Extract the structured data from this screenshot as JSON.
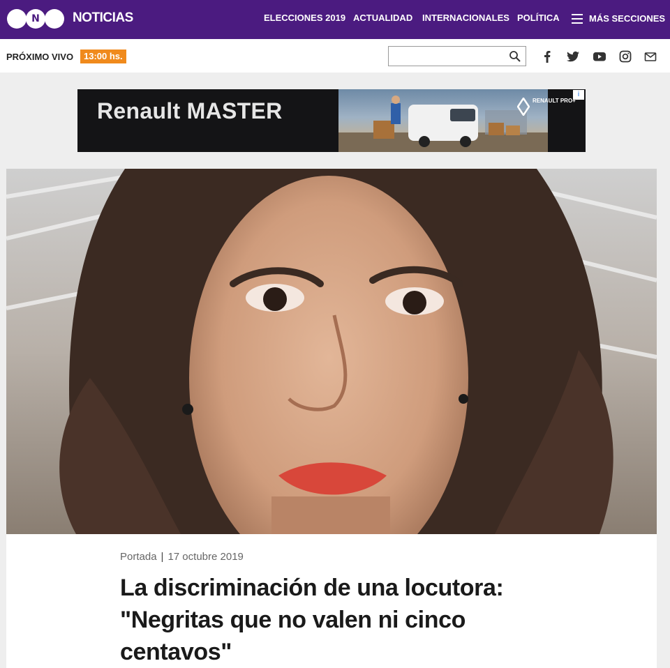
{
  "header": {
    "brand": "NOTICIAS",
    "logo_letter": "N",
    "nav": [
      "ELECCIONES 2019",
      "ACTUALIDAD",
      "INTERNACIONALES",
      "POLÍTICA"
    ],
    "more_sections": "MÁS SECCIONES",
    "color": "#4b1b80"
  },
  "subbar": {
    "next_live_label": "PRÓXIMO VIVO",
    "next_live_time": "13:00 hs.",
    "search_placeholder": "",
    "social_icons": [
      "facebook-icon",
      "twitter-icon",
      "youtube-icon",
      "instagram-icon",
      "mail-icon"
    ]
  },
  "ad": {
    "headline": "Renault MASTER",
    "brand": "RENAULT PRO+",
    "info": "i"
  },
  "article": {
    "section": "Portada",
    "separator": "|",
    "date": "17 octubre 2019",
    "title": "La discriminación de una locutora: \"Negritas que no valen ni cinco centavos\""
  }
}
